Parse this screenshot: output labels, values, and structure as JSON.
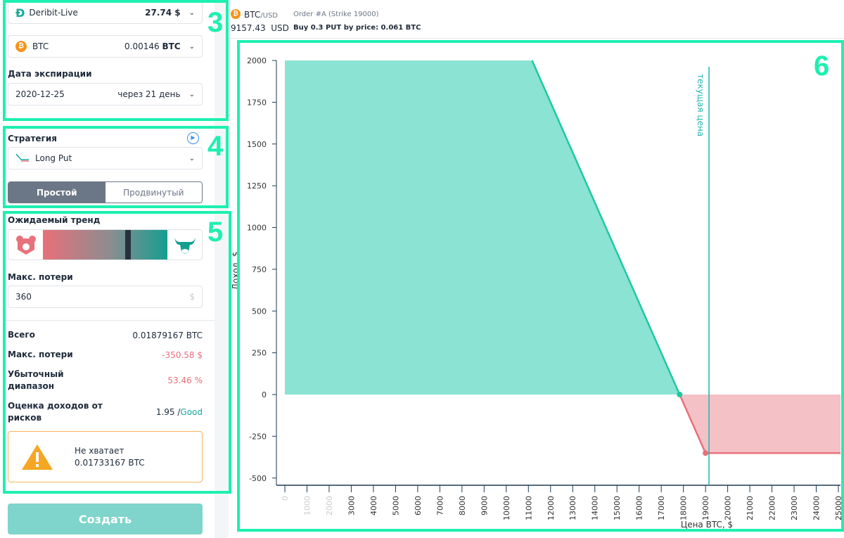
{
  "exchange": {
    "name": "Deribit-Live",
    "balance": "27.74 $",
    "icon": "deribit-logo-icon"
  },
  "asset": {
    "name": "BTC",
    "amount": "0.00146",
    "unit": "BTC"
  },
  "expiry": {
    "label": "Дата экспирации",
    "date": "2020-12-25",
    "relative": "через 21 день"
  },
  "strategy": {
    "label": "Стратегия",
    "value": "Long Put",
    "modes": [
      "Простой",
      "Продвинутый"
    ],
    "active_mode": 0
  },
  "trend": {
    "label": "Ожидаемый тренд",
    "position_percent": 67
  },
  "max_loss_input": {
    "label": "Макс. потери",
    "value": "360",
    "unit": "$"
  },
  "summary": [
    {
      "key": "Всего",
      "value": "0.01879167 BTC"
    },
    {
      "key": "Макс. потери",
      "value": "-350.58 $"
    },
    {
      "key": "Убыточный диапазон",
      "value": "53.46 %"
    },
    {
      "key": "Оценка доходов от рисков",
      "value": "1.95 /",
      "grade": "Good"
    }
  ],
  "warning": {
    "line1": "Не хватает",
    "line2": "0.01733167 BTC"
  },
  "create_label": "Создать",
  "header": {
    "pair": "BTC",
    "quote": "/USD",
    "price": "9157.43",
    "price_unit": "USD",
    "order": "Order #A (Strike 19000)",
    "order_desc": "Buy 0.3 PUT by price: 0.061 BTC"
  },
  "markers": [
    "3",
    "4",
    "5",
    "6"
  ],
  "colors": {
    "profit": "#8ae3d3",
    "loss": "#f4c1c6",
    "profit_line": "#1fc8a0",
    "loss_line": "#e8707a",
    "accent": "#1df0b0",
    "current": "#22b5b0"
  },
  "chart_data": {
    "type": "area",
    "xlabel": "Цена BTC, $",
    "ylabel": "Доход, $",
    "xlim": [
      0,
      25000
    ],
    "ylim": [
      -500,
      2000
    ],
    "xticks": [
      0,
      1000,
      2000,
      3000,
      4000,
      5000,
      6000,
      7000,
      8000,
      9000,
      10000,
      11000,
      12000,
      13000,
      14000,
      15000,
      16000,
      17000,
      18000,
      19000,
      20000,
      21000,
      22000,
      23000,
      24000,
      25000
    ],
    "yticks": [
      2000,
      1750,
      1500,
      1250,
      1000,
      750,
      500,
      250,
      0,
      -250,
      -500
    ],
    "payoff": [
      [
        0,
        2000
      ],
      [
        11165,
        2000
      ],
      [
        17831,
        0
      ],
      [
        19000,
        -350.58
      ],
      [
        25300,
        -350.58
      ]
    ],
    "breakeven": 17831,
    "strike": 19000,
    "max_loss": -350.58,
    "current_price": 19157,
    "current_label": "текущая цена"
  }
}
